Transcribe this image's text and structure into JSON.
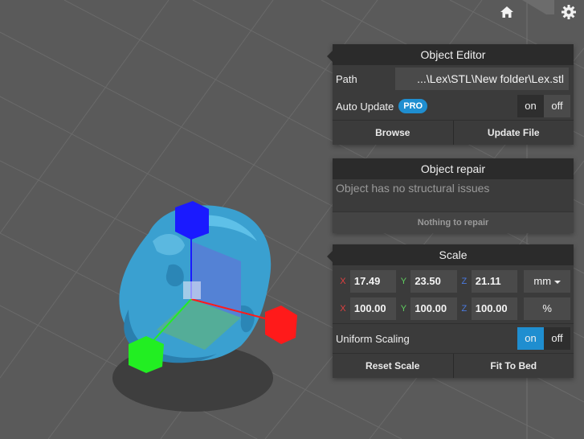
{
  "viewport": {
    "background": "#5a5a5a",
    "gizmo_colors": {
      "x": "#ff1a1a",
      "y": "#22ee22",
      "z": "#1a1aff"
    },
    "model_color": "#3aa0d0"
  },
  "toolbar": {
    "home_icon": "home-icon",
    "settings_icon": "gear-icon"
  },
  "object_editor": {
    "title": "Object Editor",
    "path_label": "Path",
    "path_value": "...\\Lex\\STL\\New folder\\Lex.stl",
    "auto_update_label": "Auto Update",
    "pro_badge": "PRO",
    "auto_update_on": "on",
    "auto_update_off": "off",
    "auto_update_selected": "off",
    "browse_label": "Browse",
    "update_file_label": "Update File"
  },
  "object_repair": {
    "title": "Object repair",
    "message": "Object has no structural issues",
    "button_label": "Nothing to repair"
  },
  "scale": {
    "title": "Scale",
    "axis_labels": {
      "x": "X",
      "y": "Y",
      "z": "Z"
    },
    "size": {
      "x": "17.49",
      "y": "23.50",
      "z": "21.11",
      "unit": "mm"
    },
    "percent": {
      "x": "100.00",
      "y": "100.00",
      "z": "100.00",
      "unit": "%"
    },
    "uniform_label": "Uniform Scaling",
    "uniform_on": "on",
    "uniform_off": "off",
    "uniform_selected": "on",
    "accent_color": "#1f8ed0",
    "reset_label": "Reset Scale",
    "fit_label": "Fit To Bed"
  }
}
